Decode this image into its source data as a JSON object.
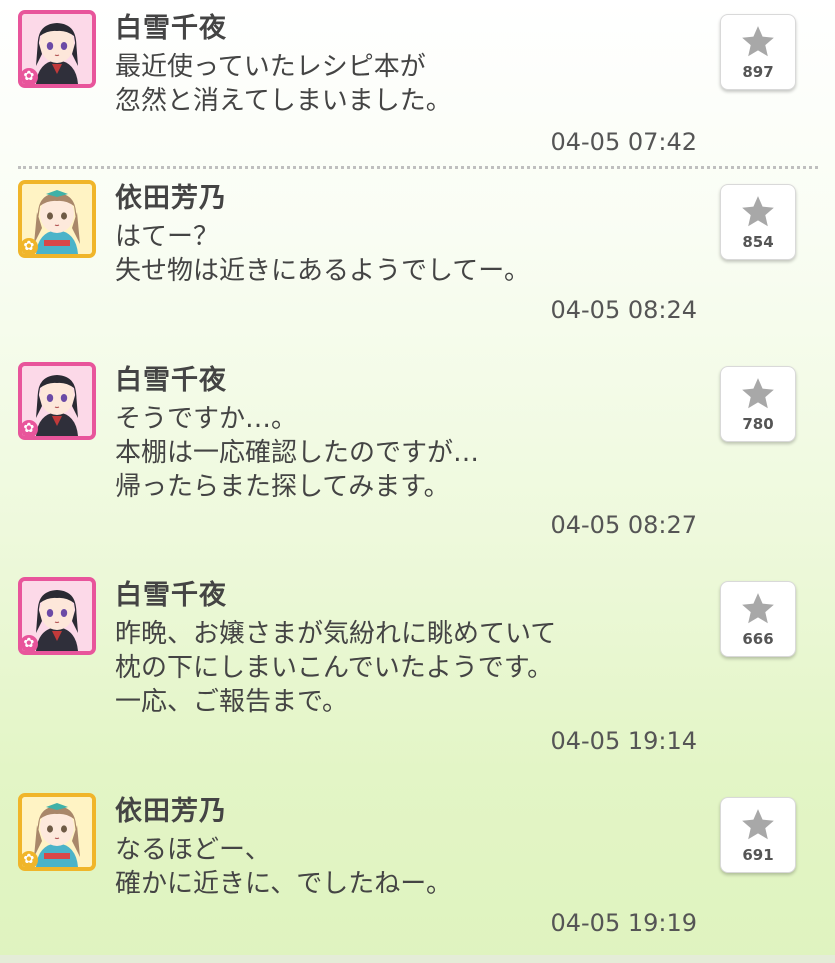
{
  "posts": [
    {
      "author": "白雪千夜",
      "avatar": "chiyo",
      "message": "最近使っていたレシピ本が\n忽然と消えてしまいました。",
      "time": "04-05 07:42",
      "likes": "897"
    },
    {
      "author": "依田芳乃",
      "avatar": "yoshino",
      "message": "はてー？\n失せ物は近きにあるようでしてー。",
      "time": "04-05 08:24",
      "likes": "854"
    },
    {
      "author": "白雪千夜",
      "avatar": "chiyo",
      "message": "そうですか…。\n本棚は一応確認したのですが…\n帰ったらまた探してみます。",
      "time": "04-05 08:27",
      "likes": "780"
    },
    {
      "author": "白雪千夜",
      "avatar": "chiyo",
      "message": "昨晩、お嬢さまが気紛れに眺めていて\n枕の下にしまいこんでいたようです。\n一応、ご報告まで。",
      "time": "04-05 19:14",
      "likes": "666"
    },
    {
      "author": "依田芳乃",
      "avatar": "yoshino",
      "message": "なるほどー、\n確かに近きに、でしたねー。",
      "time": "04-05 19:19",
      "likes": "691"
    }
  ],
  "colors": {
    "chiyo_frame": "#e8559b",
    "yoshino_frame": "#f0b52a",
    "star": "#a8a8a8"
  },
  "icons": {
    "like": "star-icon",
    "badge": "flower-icon"
  }
}
